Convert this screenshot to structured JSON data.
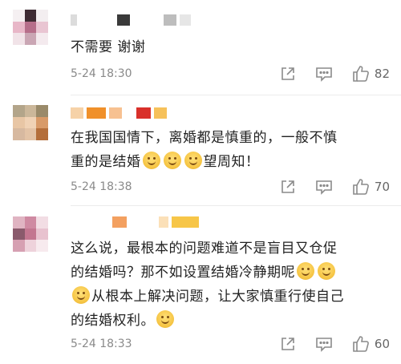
{
  "comments": [
    {
      "text_lines": [
        "不需要 谢谢"
      ],
      "time": "5-24 18:30",
      "likes": "82"
    },
    {
      "text_lines": [
        "在我国国情下，离婚都是慎重的，一般不慎",
        "重的是结婚",
        "望周知！"
      ],
      "time": "5-24 18:38",
      "likes": "70"
    },
    {
      "text_lines": [
        "这么说，最根本的问题难道不是盲目又仓促",
        "的结婚吗？那不如设置结婚冷静期呢",
        "从根本上解决问题，让大家慎重行使自己",
        "的结婚权利。"
      ],
      "time": "5-24 18:33",
      "likes": "60"
    }
  ],
  "icons": {
    "share": "share-icon",
    "reply": "comment-icon",
    "like": "thumbs-up-icon",
    "emoji": "smile-emoji-icon"
  },
  "colors": {
    "meta_text": "#8a8a8a",
    "divider": "#ececec"
  }
}
